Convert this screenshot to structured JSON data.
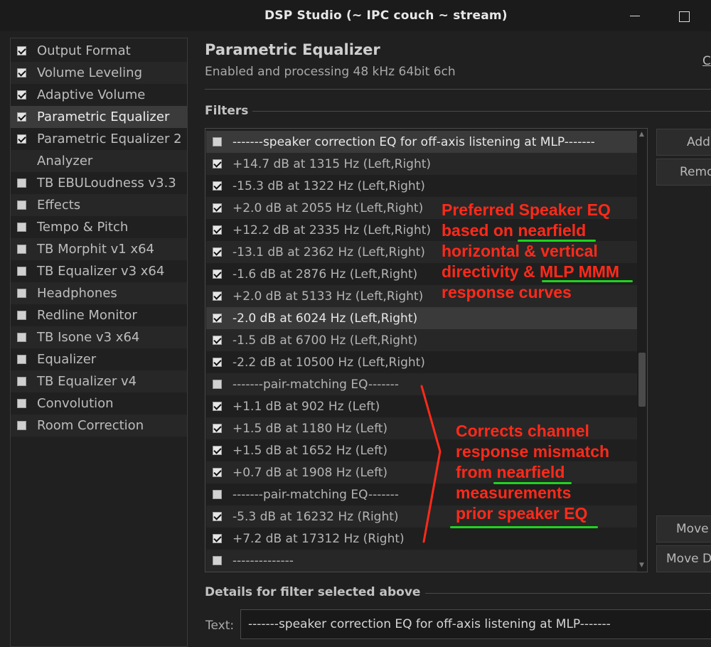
{
  "window": {
    "title": "DSP Studio (~ IPC couch ~ stream)"
  },
  "sidebar": {
    "items": [
      {
        "label": "Output Format",
        "checkbox": "checked"
      },
      {
        "label": "Volume Leveling",
        "checkbox": "checked"
      },
      {
        "label": "Adaptive Volume",
        "checkbox": "checked"
      },
      {
        "label": "Parametric Equalizer",
        "checkbox": "checked",
        "selected": true
      },
      {
        "label": "Parametric Equalizer 2",
        "checkbox": "checked"
      },
      {
        "label": "Analyzer",
        "checkbox": "none"
      },
      {
        "label": "TB EBULoudness v3.3",
        "checkbox": "unchecked"
      },
      {
        "label": "Effects",
        "checkbox": "unchecked"
      },
      {
        "label": "Tempo & Pitch",
        "checkbox": "unchecked"
      },
      {
        "label": "TB Morphit v1 x64",
        "checkbox": "unchecked"
      },
      {
        "label": "TB Equalizer v3 x64",
        "checkbox": "unchecked"
      },
      {
        "label": "Headphones",
        "checkbox": "unchecked"
      },
      {
        "label": "Redline Monitor",
        "checkbox": "unchecked"
      },
      {
        "label": "TB Isone v3 x64",
        "checkbox": "unchecked"
      },
      {
        "label": "Equalizer",
        "checkbox": "unchecked"
      },
      {
        "label": "TB Equalizer v4",
        "checkbox": "unchecked"
      },
      {
        "label": "Convolution",
        "checkbox": "unchecked"
      },
      {
        "label": "Room Correction",
        "checkbox": "unchecked"
      }
    ]
  },
  "main": {
    "title": "Parametric Equalizer",
    "status": "Enabled and processing 48 kHz 64bit 6ch",
    "corner_link": "C",
    "filters_heading": "Filters",
    "filters": [
      {
        "label": "-------speaker correction EQ for off-axis listening at MLP-------",
        "checked": false,
        "selected": true
      },
      {
        "label": "+14.7 dB at 1315 Hz (Left,Right)",
        "checked": true
      },
      {
        "label": "-15.3 dB at 1322 Hz (Left,Right)",
        "checked": true
      },
      {
        "label": "+2.0 dB at 2055 Hz (Left,Right)",
        "checked": true
      },
      {
        "label": "+12.2 dB at 2335 Hz (Left,Right)",
        "checked": true
      },
      {
        "label": "-13.1 dB at 2362 Hz (Left,Right)",
        "checked": true
      },
      {
        "label": "-1.6 dB at 2876 Hz (Left,Right)",
        "checked": true
      },
      {
        "label": "+2.0 dB at 5133 Hz (Left,Right)",
        "checked": true
      },
      {
        "label": "-2.0 dB at 6024 Hz (Left,Right)",
        "checked": true,
        "highlight": true
      },
      {
        "label": "-1.5 dB at 6700 Hz (Left,Right)",
        "checked": true
      },
      {
        "label": "-2.2 dB at 10500 Hz (Left,Right)",
        "checked": true
      },
      {
        "label": "-------pair-matching EQ-------",
        "checked": false
      },
      {
        "label": "+1.1 dB at 902 Hz (Left)",
        "checked": true
      },
      {
        "label": "+1.5 dB at 1180 Hz (Left)",
        "checked": true
      },
      {
        "label": "+1.5 dB at 1652 Hz (Left)",
        "checked": true
      },
      {
        "label": "+0.7 dB at 1908 Hz (Left)",
        "checked": true
      },
      {
        "label": "-------pair-matching EQ-------",
        "checked": false
      },
      {
        "label": "-5.3 dB at 16232 Hz (Right)",
        "checked": true
      },
      {
        "label": "+7.2 dB at 17312 Hz (Right)",
        "checked": true
      },
      {
        "label": "--------------",
        "checked": false
      }
    ],
    "buttons": {
      "add": "Add",
      "remove": "Remo",
      "move_up": "Move",
      "move_down": "Move D"
    },
    "details_heading": "Details for filter selected above",
    "text_label": "Text:",
    "text_value": "-------speaker correction EQ for off-axis listening at MLP-------"
  },
  "annotations": {
    "top": [
      "Preferred Speaker EQ",
      "based on nearfield",
      "horizontal & vertical",
      "directivity & MLP MMM",
      "response curves"
    ],
    "bottom": [
      "Corrects channel",
      "response mismatch",
      "from nearfield",
      "measurements",
      "prior speaker EQ"
    ],
    "text_color": "#ff2a1a",
    "underline_color": "#1fd31f"
  }
}
